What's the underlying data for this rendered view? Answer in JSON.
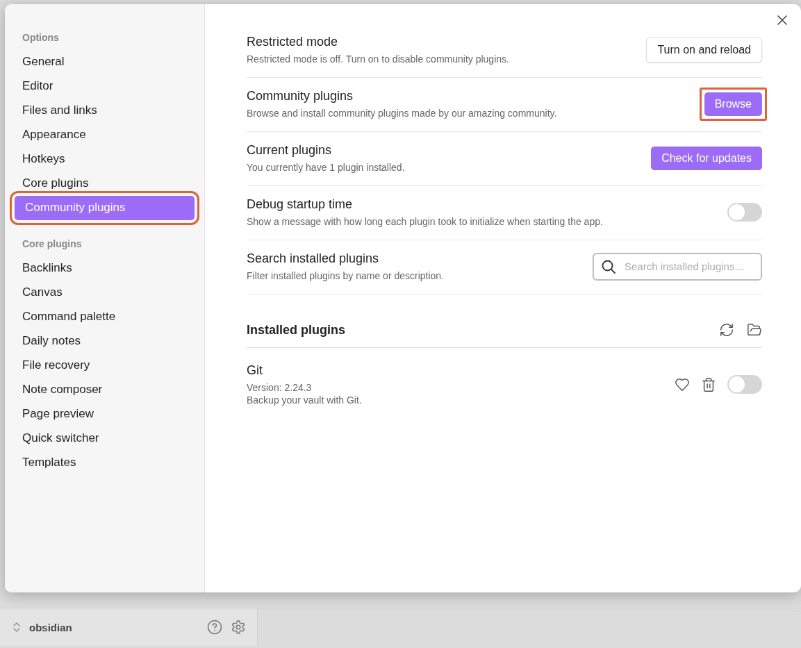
{
  "sidebar": {
    "sections": [
      {
        "title": "Options",
        "items": [
          {
            "label": "General",
            "selected": false,
            "highlighted": false
          },
          {
            "label": "Editor",
            "selected": false,
            "highlighted": false
          },
          {
            "label": "Files and links",
            "selected": false,
            "highlighted": false
          },
          {
            "label": "Appearance",
            "selected": false,
            "highlighted": false
          },
          {
            "label": "Hotkeys",
            "selected": false,
            "highlighted": false
          },
          {
            "label": "Core plugins",
            "selected": false,
            "highlighted": false
          },
          {
            "label": "Community plugins",
            "selected": true,
            "highlighted": true
          }
        ]
      },
      {
        "title": "Core plugins",
        "items": [
          {
            "label": "Backlinks",
            "selected": false,
            "highlighted": false
          },
          {
            "label": "Canvas",
            "selected": false,
            "highlighted": false
          },
          {
            "label": "Command palette",
            "selected": false,
            "highlighted": false
          },
          {
            "label": "Daily notes",
            "selected": false,
            "highlighted": false
          },
          {
            "label": "File recovery",
            "selected": false,
            "highlighted": false
          },
          {
            "label": "Note composer",
            "selected": false,
            "highlighted": false
          },
          {
            "label": "Page preview",
            "selected": false,
            "highlighted": false
          },
          {
            "label": "Quick switcher",
            "selected": false,
            "highlighted": false
          },
          {
            "label": "Templates",
            "selected": false,
            "highlighted": false
          }
        ]
      }
    ]
  },
  "settings": [
    {
      "name": "Restricted mode",
      "description": "Restricted mode is off. Turn on to disable community plugins.",
      "kind": "button",
      "button": {
        "label": "Turn on and reload",
        "primary": false,
        "highlighted": false
      }
    },
    {
      "name": "Community plugins",
      "description": "Browse and install community plugins made by our amazing community.",
      "kind": "button",
      "button": {
        "label": "Browse",
        "primary": true,
        "highlighted": true
      }
    },
    {
      "name": "Current plugins",
      "description": "You currently have 1 plugin installed.",
      "kind": "button",
      "button": {
        "label": "Check for updates",
        "primary": true,
        "highlighted": false
      }
    },
    {
      "name": "Debug startup time",
      "description": "Show a message with how long each plugin took to initialize when starting the app.",
      "kind": "toggle",
      "on": false
    },
    {
      "name": "Search installed plugins",
      "description": "Filter installed plugins by name or description.",
      "kind": "search",
      "placeholder": "Search installed plugins..."
    }
  ],
  "installed": {
    "title": "Installed plugins",
    "plugins": [
      {
        "name": "Git",
        "version": "Version: 2.24.3",
        "description": "Backup your vault with Git.",
        "on": false
      }
    ]
  },
  "vault": {
    "name": "obsidian"
  }
}
